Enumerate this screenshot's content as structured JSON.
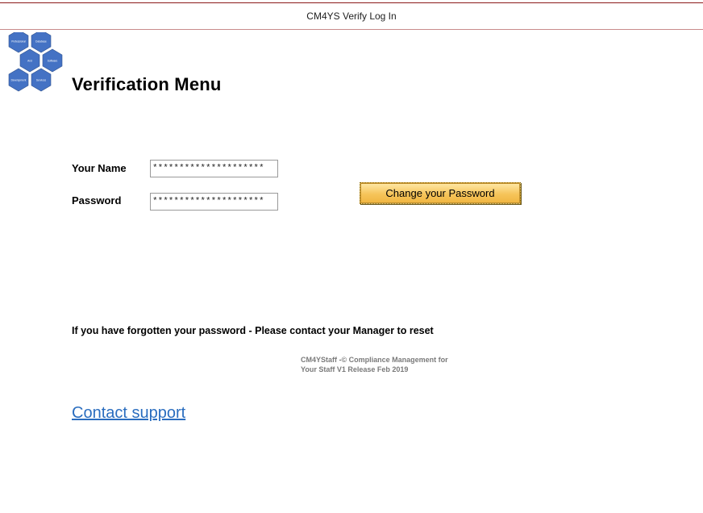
{
  "window": {
    "title": "CM4YS Verify Log In"
  },
  "logo": {
    "hexagons": [
      "Professional",
      "Database",
      "And",
      "Software",
      "Development",
      "Services"
    ],
    "color": "#4472c4"
  },
  "header": {
    "title": "Verification Menu"
  },
  "form": {
    "name_label": "Your Name",
    "name_value": "*********************",
    "password_label": "Password",
    "password_value": "*********************"
  },
  "actions": {
    "change_password_label": "Change your Password"
  },
  "notice": {
    "forgot_text": "If you have forgotten your password - Please contact your Manager to reset"
  },
  "footer": {
    "copyright_line1": "CM4YStaff -© Compliance Management for",
    "copyright_line2": "Your Staff  V1 Release Feb 2019",
    "support_link": "Contact support"
  }
}
